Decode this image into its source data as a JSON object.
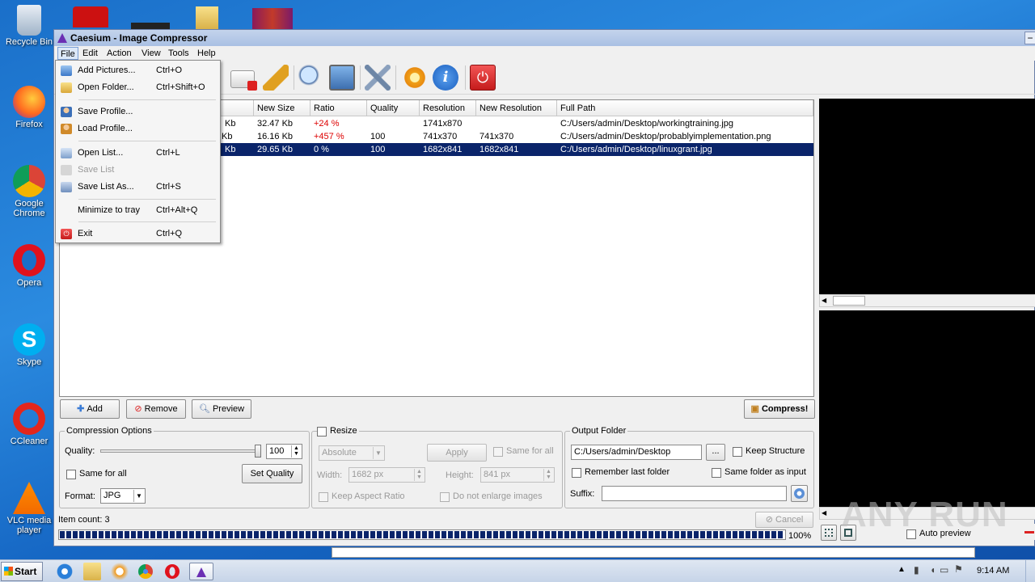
{
  "desktop": {
    "icons": [
      {
        "label": "Recycle Bin"
      },
      {
        "label": "Firefox"
      },
      {
        "label": "Google Chrome"
      },
      {
        "label": "Opera"
      },
      {
        "label": "Skype"
      },
      {
        "label": "CCleaner"
      },
      {
        "label": "VLC media player"
      }
    ]
  },
  "window": {
    "title": "Caesium - Image Compressor",
    "menus": [
      "File",
      "Edit",
      "Action",
      "View",
      "Tools",
      "Help"
    ],
    "active_menu": "File"
  },
  "file_menu": {
    "items": [
      {
        "label": "Add Pictures...",
        "shortcut": "Ctrl+O",
        "enabled": true
      },
      {
        "label": "Open Folder...",
        "shortcut": "Ctrl+Shift+O",
        "enabled": true
      },
      {
        "label": "Save Profile...",
        "shortcut": "",
        "enabled": true
      },
      {
        "label": "Load Profile...",
        "shortcut": "",
        "enabled": true
      },
      {
        "label": "Open List...",
        "shortcut": "Ctrl+L",
        "enabled": true
      },
      {
        "label": "Save List",
        "shortcut": "",
        "enabled": false
      },
      {
        "label": "Save List As...",
        "shortcut": "Ctrl+S",
        "enabled": true
      },
      {
        "label": "Minimize to tray",
        "shortcut": "Ctrl+Alt+Q",
        "enabled": true
      },
      {
        "label": "Exit",
        "shortcut": "Ctrl+Q",
        "enabled": true
      }
    ]
  },
  "table": {
    "columns": [
      "New Size",
      "Ratio",
      "Quality",
      "Resolution",
      "New Resolution",
      "Full Path"
    ],
    "rows": [
      {
        "size_tail": "Kb",
        "new_size": "32.47 Kb",
        "ratio": "+24 %",
        "quality": "",
        "resolution": "1741x870",
        "new_resolution": "",
        "path": "C:/Users/admin/Desktop/workingtraining.jpg",
        "selected": false
      },
      {
        "size_tail": "Kb",
        "new_size": "16.16 Kb",
        "ratio": "+457 %",
        "quality": "100",
        "resolution": "741x370",
        "new_resolution": "741x370",
        "path": "C:/Users/admin/Desktop/probablyimplementation.png",
        "selected": false
      },
      {
        "size_tail": "Kb",
        "new_size": "29.65 Kb",
        "ratio": "0 %",
        "quality": "100",
        "resolution": "1682x841",
        "new_resolution": "1682x841",
        "path": "C:/Users/admin/Desktop/linuxgrant.jpg",
        "selected": true
      }
    ]
  },
  "buttons": {
    "add": "Add",
    "remove": "Remove",
    "preview": "Preview",
    "compress": "Compress!"
  },
  "compression": {
    "title": "Compression Options",
    "quality_label": "Quality:",
    "quality_value": "100",
    "quality_percent": 100,
    "same_for_all": "Same for all",
    "set_quality": "Set Quality",
    "format_label": "Format:",
    "format_value": "JPG"
  },
  "resize": {
    "title": "Resize",
    "mode": "Absolute",
    "apply": "Apply",
    "same_for_all": "Same for all",
    "width_label": "Width:",
    "width_value": "1682 px",
    "height_label": "Height:",
    "height_value": "841 px",
    "keep_aspect": "Keep Aspect Ratio",
    "no_enlarge": "Do not enlarge images"
  },
  "output": {
    "title": "Output Folder",
    "path": "C:/Users/admin/Desktop",
    "browse": "...",
    "keep_structure": "Keep Structure",
    "remember_last": "Remember last folder",
    "same_folder": "Same folder as input",
    "suffix_label": "Suffix:",
    "suffix_value": ""
  },
  "status": {
    "item_count": "Item count: 3",
    "cancel": "Cancel",
    "progress_text": "100%",
    "progress_value": 100
  },
  "preview_panel": {
    "auto_preview": "Auto preview"
  },
  "taskbar": {
    "start": "Start",
    "clock": "9:14 AM"
  },
  "watermark": "ANY RUN"
}
